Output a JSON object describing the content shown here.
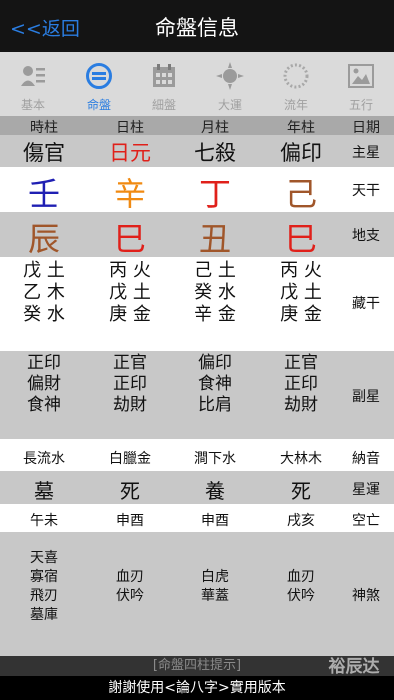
{
  "nav": {
    "back": "<<返回",
    "title": "命盤信息"
  },
  "tabs": [
    "基本",
    "命盤",
    "細盤",
    "大運",
    "流年",
    "五行"
  ],
  "headers": [
    "時柱",
    "日柱",
    "月柱",
    "年柱",
    "日期"
  ],
  "zhuxing": {
    "values": [
      "傷官",
      "日元",
      "七殺",
      "偏印"
    ],
    "label": "主星"
  },
  "tiangan": {
    "values": [
      "壬",
      "辛",
      "丁",
      "己"
    ],
    "label": "天干"
  },
  "dizhi": {
    "values": [
      "辰",
      "巳",
      "丑",
      "巳"
    ],
    "label": "地支"
  },
  "canggan": {
    "label": "藏干",
    "cols": [
      [
        "戊 土",
        "乙 木",
        "癸 水"
      ],
      [
        "丙 火",
        "戊 土",
        "庚 金"
      ],
      [
        "己 土",
        "癸 水",
        "辛 金"
      ],
      [
        "丙 火",
        "戊 土",
        "庚 金"
      ]
    ]
  },
  "fuxing": {
    "label": "副星",
    "cols": [
      [
        "正印",
        "偏財",
        "食神"
      ],
      [
        "正官",
        "正印",
        "劫財"
      ],
      [
        "偏印",
        "食神",
        "比肩"
      ],
      [
        "正官",
        "正印",
        "劫財"
      ]
    ]
  },
  "nayin": {
    "values": [
      "長流水",
      "白臘金",
      "澗下水",
      "大林木"
    ],
    "label": "納音"
  },
  "xingyun": {
    "values": [
      "墓",
      "死",
      "養",
      "死"
    ],
    "label": "星運"
  },
  "kongwang": {
    "values": [
      "午未",
      "申酉",
      "申酉",
      "戌亥"
    ],
    "label": "空亡"
  },
  "shensha": {
    "label": "神煞",
    "cols": [
      [
        "天喜",
        "寡宿",
        "飛刃",
        "墓庫"
      ],
      [
        "血刃",
        "伏吟"
      ],
      [
        "白虎",
        "華蓋"
      ],
      [
        "血刃",
        "伏吟"
      ]
    ]
  },
  "tip": "[命盤四柱提示]",
  "footer": "謝謝使用<論八字>實用版本",
  "watermark": "裕辰达",
  "colors": {
    "accent": "#2a7de1",
    "red": "#e0201a",
    "blue": "#1f1fb3",
    "orange": "#f08a12",
    "brown": "#a0562a"
  }
}
